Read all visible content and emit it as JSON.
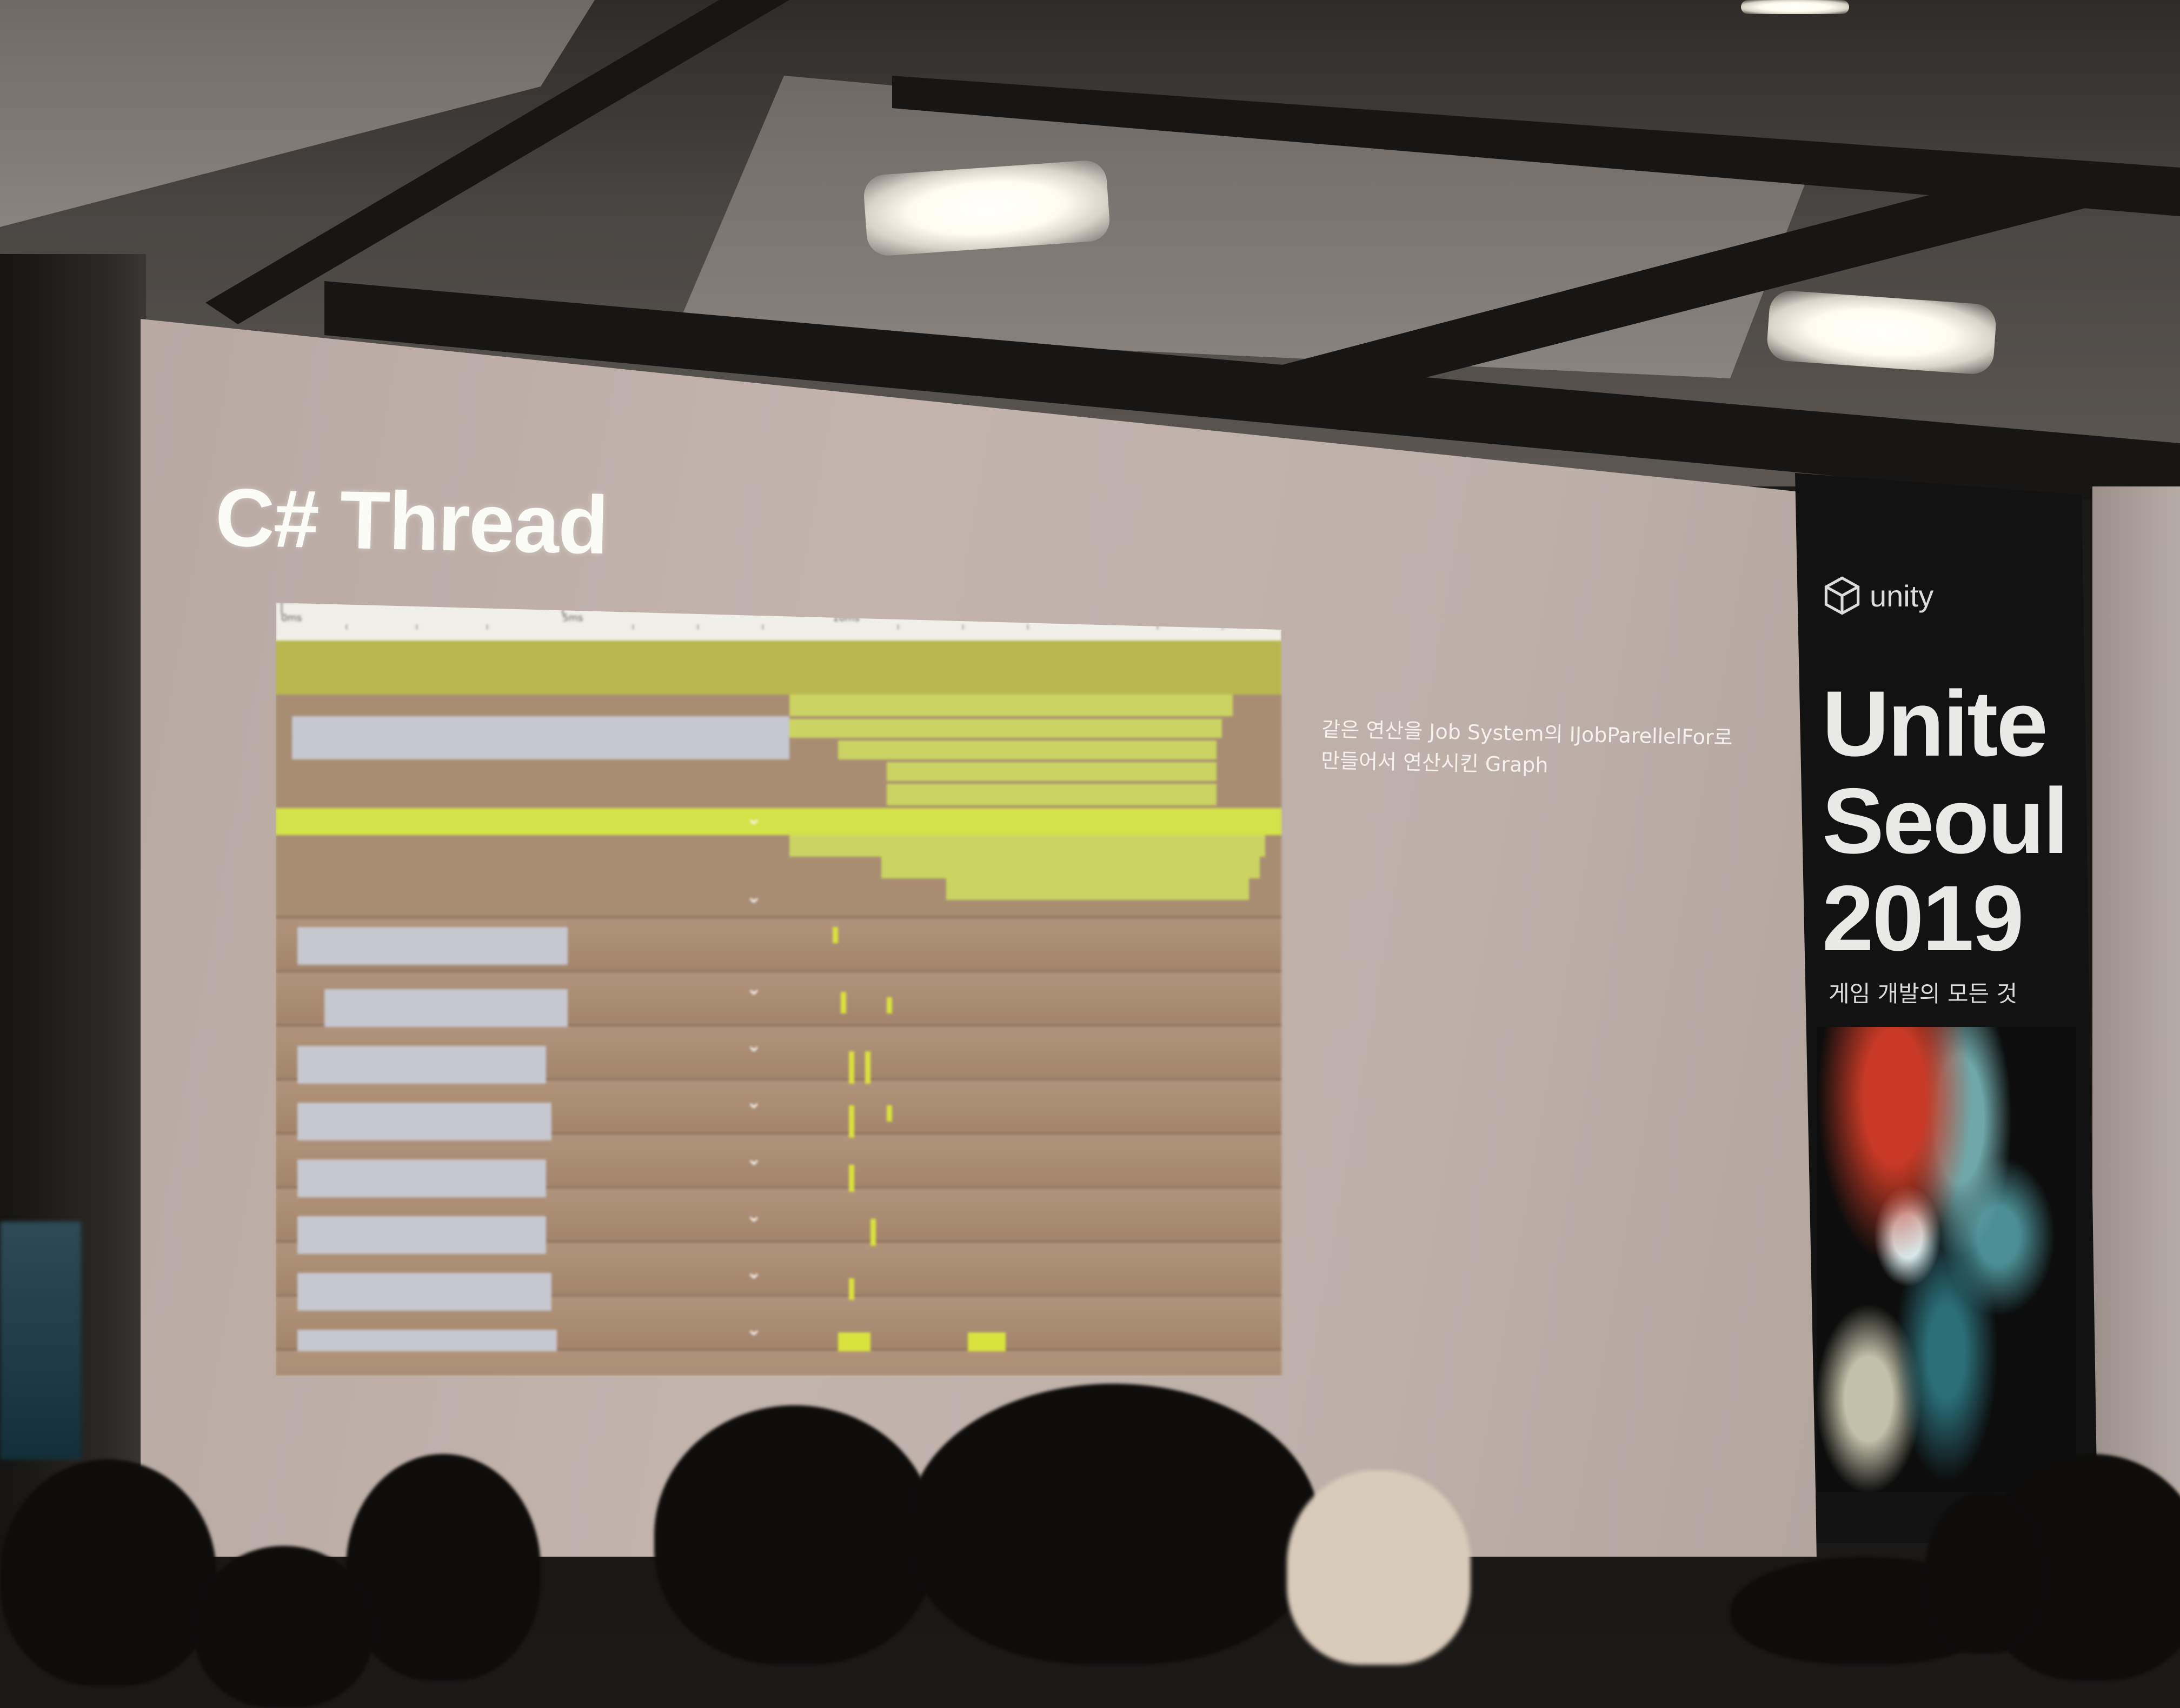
{
  "slide": {
    "title": "C# Thread",
    "caption_line_1": "같은 연산을 Job System의 IJobParellelFor로",
    "caption_line_2": "만들어서 연산시킨 Graph"
  },
  "profiler": {
    "ruler_labels": [
      "0ms",
      "5ms",
      "10ms",
      "15ms"
    ]
  },
  "banner": {
    "logo_text": "unity",
    "line_1": "Unite",
    "line_2": "Seoul",
    "line_3": "2019",
    "subtitle": "게임 개발의 모든 것"
  },
  "colors": {
    "profiler_bg": "#a88d73",
    "profiler_green": "#cbd462",
    "profiler_lime": "#d4e24a",
    "job_bar": "#c6c7cf",
    "banner_bg": "#121212"
  }
}
